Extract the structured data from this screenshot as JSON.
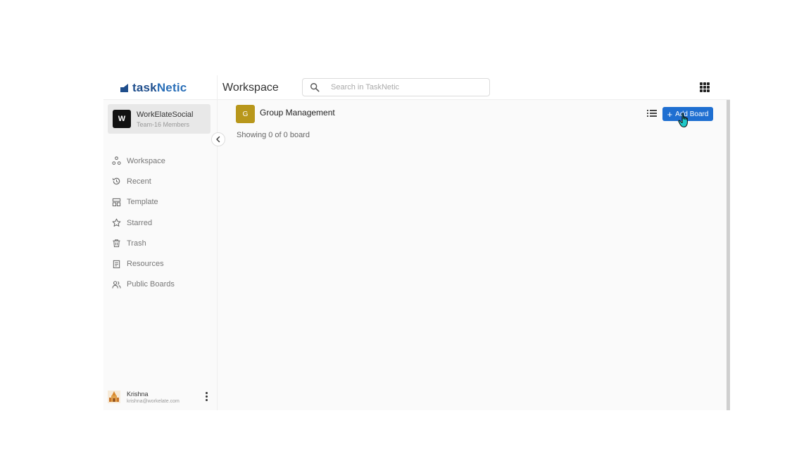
{
  "header": {
    "logo_text_a": "task",
    "logo_text_b": "Netic",
    "page_title": "Workspace",
    "search_placeholder": "Search in TaskNetic"
  },
  "sidebar": {
    "team": {
      "initial": "W",
      "name": "WorkElateSocial",
      "members": "Team-16 Members"
    },
    "items": [
      {
        "label": "Workspace",
        "icon": "workspace-icon"
      },
      {
        "label": "Recent",
        "icon": "history-icon"
      },
      {
        "label": "Template",
        "icon": "template-icon"
      },
      {
        "label": "Starred",
        "icon": "star-icon"
      },
      {
        "label": "Trash",
        "icon": "trash-icon"
      },
      {
        "label": "Resources",
        "icon": "document-icon"
      },
      {
        "label": "Public Boards",
        "icon": "users-icon"
      }
    ],
    "user": {
      "name": "Krishna",
      "email": "krishna@workelate.com"
    }
  },
  "main": {
    "group_initial": "G",
    "group_title": "Group Management",
    "showing": "Showing 0 of 0 board",
    "add_board_label": "Add Board"
  },
  "colors": {
    "brand": "#1f4e8c",
    "primary_button": "#1f6fd1",
    "group_badge": "#b8971b"
  }
}
